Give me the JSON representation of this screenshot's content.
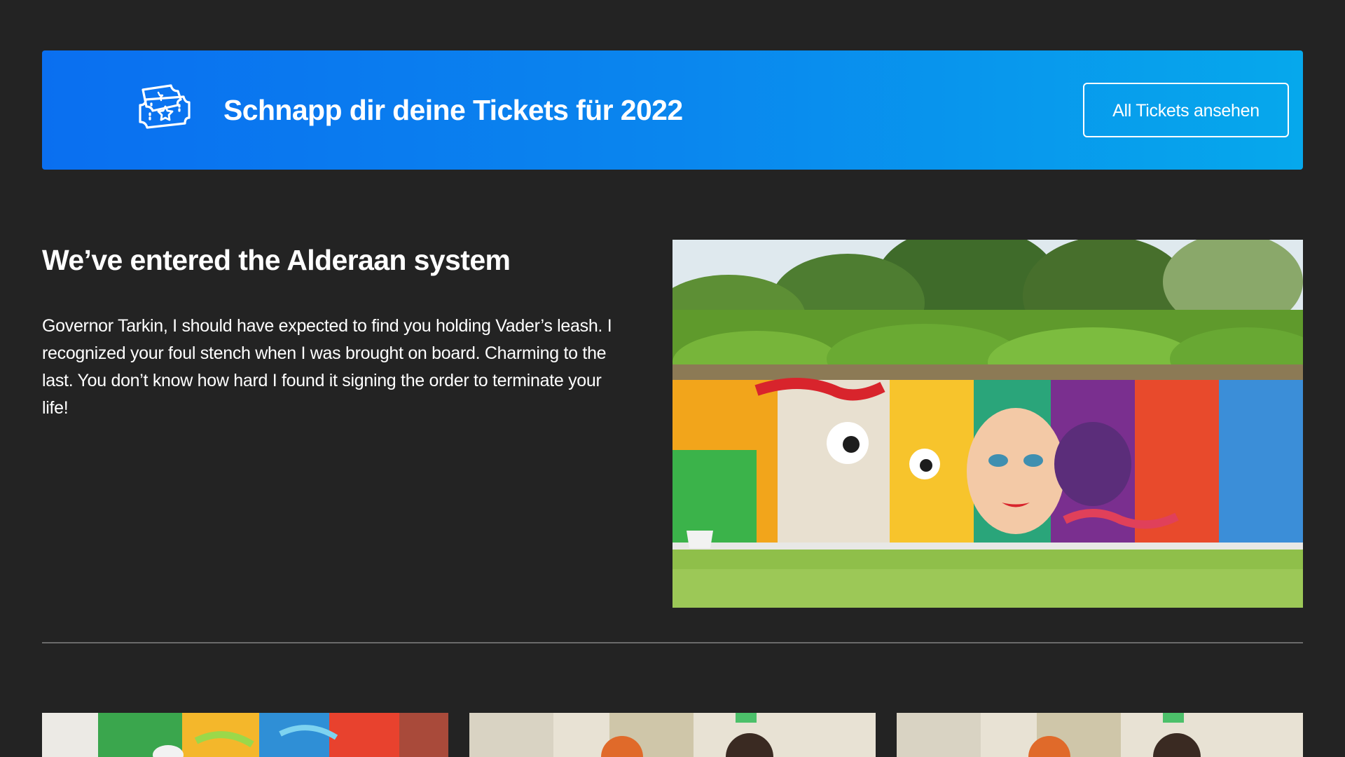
{
  "banner": {
    "title": "Schnapp dir deine Tickets für 2022",
    "button_label": "All Tickets ansehen",
    "icon": "ticket-icon",
    "gradient_start": "#0a6ff0",
    "gradient_end": "#06a8ec"
  },
  "article": {
    "heading": "We’ve entered the Alderaan system",
    "body": "Governor Tarkin, I should have expected to find you holding Vader’s leash. I recognized your foul stench when I was brought on board. Charming to the last. You don’t know how hard I found it signing the order to terminate your life!",
    "image": "mural-photo"
  },
  "cards": [
    {
      "image": "graffiti-photo"
    },
    {
      "image": "people-photo"
    },
    {
      "image": "people-photo"
    }
  ],
  "colors": {
    "background": "#232323",
    "divider": "#6a6a6a"
  }
}
